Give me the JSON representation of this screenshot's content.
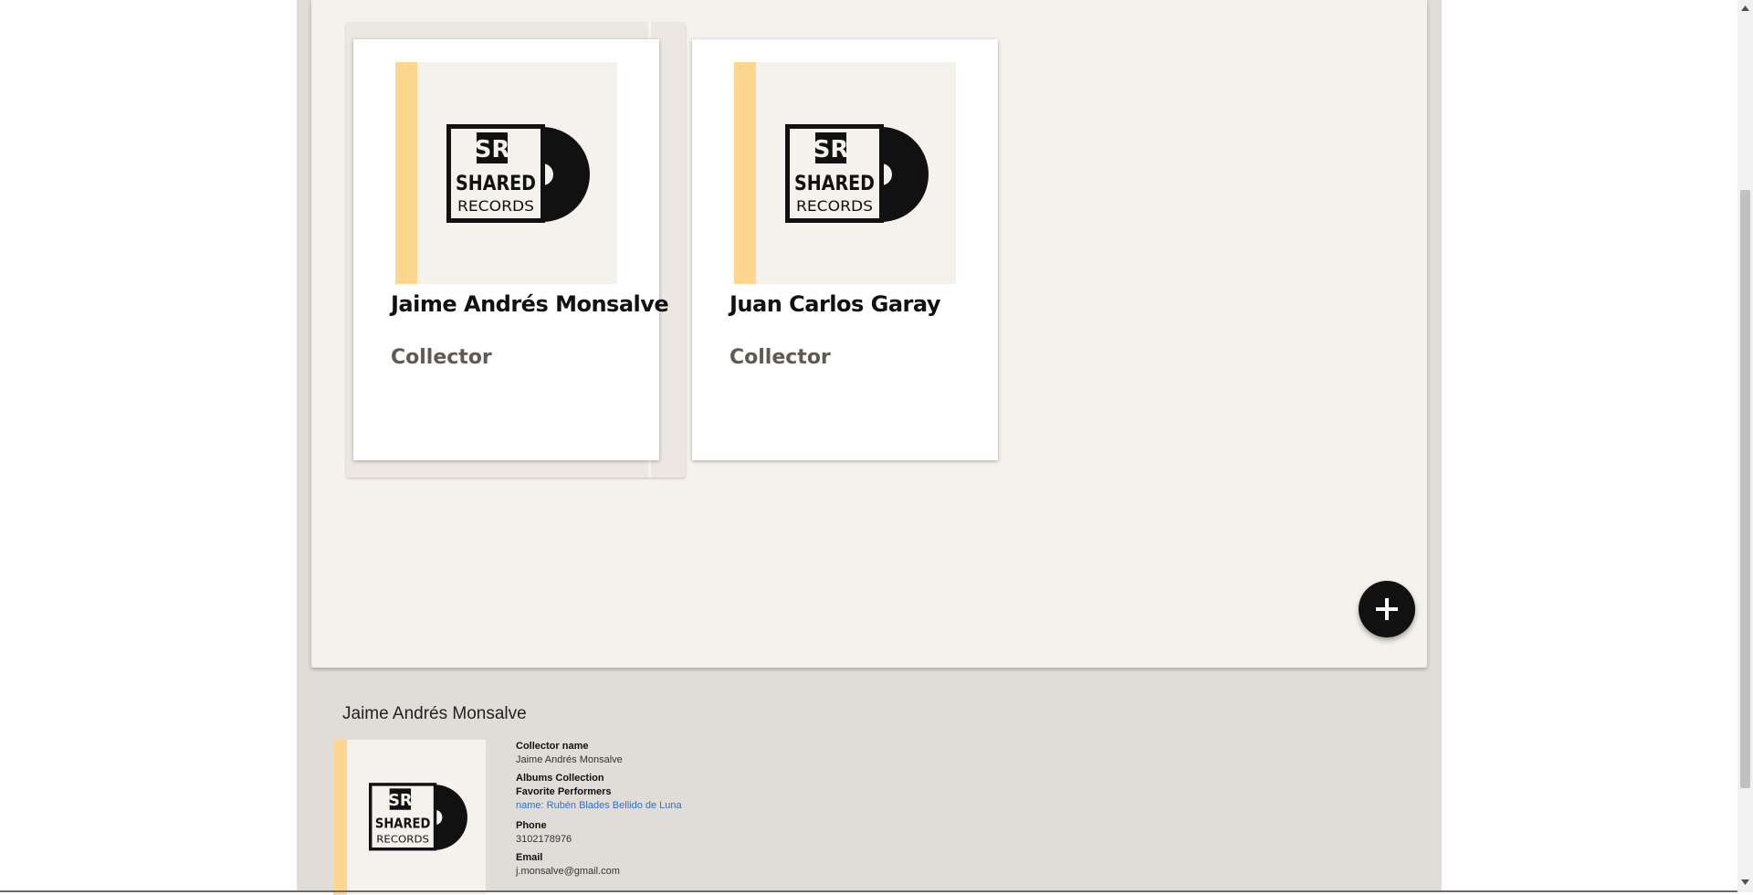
{
  "collectors": [
    {
      "name": "Jaime Andrés Monsalve",
      "role": "Collector"
    },
    {
      "name": "Juan Carlos Garay",
      "role": "Collector"
    }
  ],
  "cover": {
    "logo_top": "SR",
    "logo_mid": "SHARED",
    "logo_bottom": "RECORDS"
  },
  "fab": {
    "icon": "plus-icon"
  },
  "detail": {
    "title": "Jaime Andrés Monsalve",
    "fields": {
      "collector_name_label": "Collector name",
      "collector_name_value": "Jaime Andrés Monsalve",
      "albums_label": "Albums Collection",
      "performers_label": "Favorite Performers",
      "performer_link": "name: Rubén Blades Bellido de Luna",
      "phone_label": "Phone",
      "phone_value": "3102178976",
      "email_label": "Email",
      "email_value": "j.monsalve@gmail.com"
    }
  },
  "colors": {
    "panel_bg": "#f5f1ec",
    "shell_bg": "#e0dcd7",
    "accent_stripe": "#fdd78f",
    "fab_bg": "#111111",
    "link": "#2a72d6"
  }
}
